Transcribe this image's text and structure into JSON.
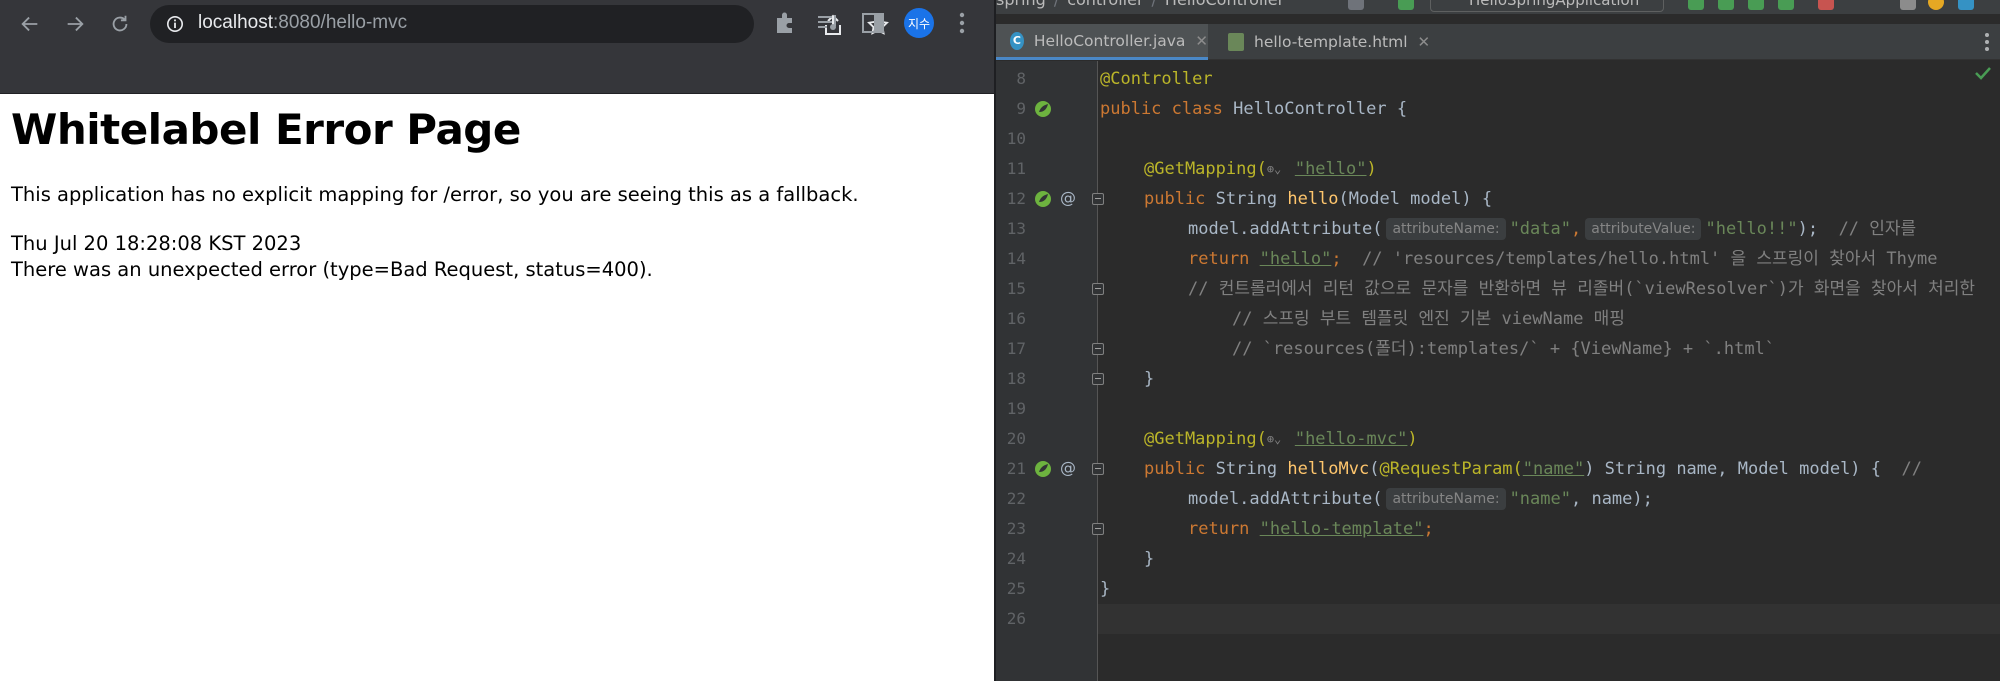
{
  "browser": {
    "url_host": "localhost",
    "url_path": ":8080/hello-mvc",
    "profile_label": "지수",
    "icons": [
      "back-arrow-icon",
      "forward-arrow-icon",
      "reload-icon",
      "info-icon",
      "share-icon",
      "star-icon",
      "extensions-icon",
      "media-control-icon",
      "side-panel-icon",
      "more-icon"
    ]
  },
  "error_page": {
    "title": "Whitelabel Error Page",
    "message": "This application has no explicit mapping for /error, so you are seeing this as a fallback.",
    "timestamp": "Thu Jul 20 18:28:08 KST 2023",
    "detail": "There was an unexpected error (type=Bad Request, status=400)."
  },
  "ide": {
    "breadcrumbs": [
      "spring",
      "controller",
      "HelloController"
    ],
    "run_config": "HelloSpringApplication",
    "tabs": [
      {
        "label": "HelloController.java",
        "active": true
      },
      {
        "label": "hello-template.html",
        "active": false
      }
    ],
    "lines": [
      {
        "n": "8"
      },
      {
        "n": "9"
      },
      {
        "n": "10"
      },
      {
        "n": "11"
      },
      {
        "n": "12"
      },
      {
        "n": "13"
      },
      {
        "n": "14"
      },
      {
        "n": "15"
      },
      {
        "n": "16"
      },
      {
        "n": "17"
      },
      {
        "n": "18"
      },
      {
        "n": "19"
      },
      {
        "n": "20"
      },
      {
        "n": "21"
      },
      {
        "n": "22"
      },
      {
        "n": "23"
      },
      {
        "n": "24"
      },
      {
        "n": "25"
      },
      {
        "n": "26"
      }
    ],
    "code": {
      "l8_annotation": "@Controller",
      "l9_public": "public",
      "l9_class": "class",
      "l9_name": "HelloController {",
      "l11_annotation": "@GetMapping(",
      "l11_value": "\"hello\"",
      "l11_close": ")",
      "l12_public": "public",
      "l12_type": "String",
      "l12_method": "hello",
      "l12_params": "(Model model) {",
      "l13_call": "model.addAttribute(",
      "l13_hint1": "attributeName:",
      "l13_arg1": "\"data\"",
      "l13_comma": ",",
      "l13_hint2": "attributeValue:",
      "l13_arg2": "\"hello!!\"",
      "l13_end": ");",
      "l13_comment": "// 인자를",
      "l14_return": "return",
      "l14_value": "\"hello\"",
      "l14_semi": ";",
      "l14_comment": "// 'resources/templates/hello.html' 을 스프링이 찾아서 Thyme",
      "l15_comment": "// 컨트롤러에서 리턴 값으로 문자를 반환하면 뷰 리졸버(`viewResolver`)가 화면을 찾아서 처리한",
      "l16_comment": "// 스프링 부트 템플릿 엔진 기본 viewName 매핑",
      "l17_comment": "// `resources(폴더):templates/` + {ViewName} + `.html`",
      "l18_brace": "}",
      "l20_annotation": "@GetMapping(",
      "l20_value": "\"hello-mvc\"",
      "l20_close": ")",
      "l21_public": "public",
      "l21_type": "String",
      "l21_method": "helloMvc",
      "l21_open": "(",
      "l21_ann": "@RequestParam(",
      "l21_param": "\"name\"",
      "l21_rest": ") String name, Model model) {",
      "l21_comment": "//",
      "l22_call": "model.addAttribute(",
      "l22_hint": "attributeName:",
      "l22_arg1": "\"name\"",
      "l22_rest": ", name);",
      "l23_return": "return",
      "l23_value": "\"hello-template\"",
      "l23_semi": ";",
      "l24_brace": "}",
      "l25_brace": "}"
    },
    "colors": {
      "keyword": "#cc7832",
      "annotation": "#bbb529",
      "string": "#6a8759",
      "method": "#ffc66d",
      "comment": "#808080"
    }
  }
}
